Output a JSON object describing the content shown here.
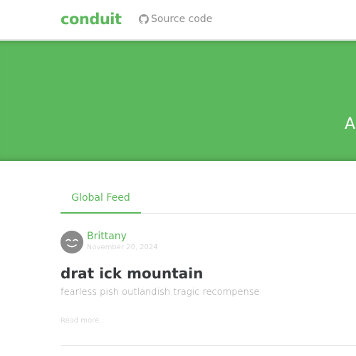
{
  "navbar": {
    "brand": "conduit",
    "source_link": {
      "label": "Source code",
      "icon": "github-icon"
    }
  },
  "banner": {
    "title": "A",
    "color": "#5cb85c"
  },
  "feed": {
    "tabs": [
      {
        "label": "Global Feed",
        "active": true
      }
    ]
  },
  "articles": [
    {
      "author": "Brittany",
      "date": "November 20, 2024",
      "title": "drat ick mountain",
      "description": "fearless pish outlandish tragic recompense",
      "read_more": "Read more..."
    }
  ],
  "colors": {
    "accent": "#5cb85c",
    "muted": "#bbbbbb",
    "text": "#373a3c"
  }
}
